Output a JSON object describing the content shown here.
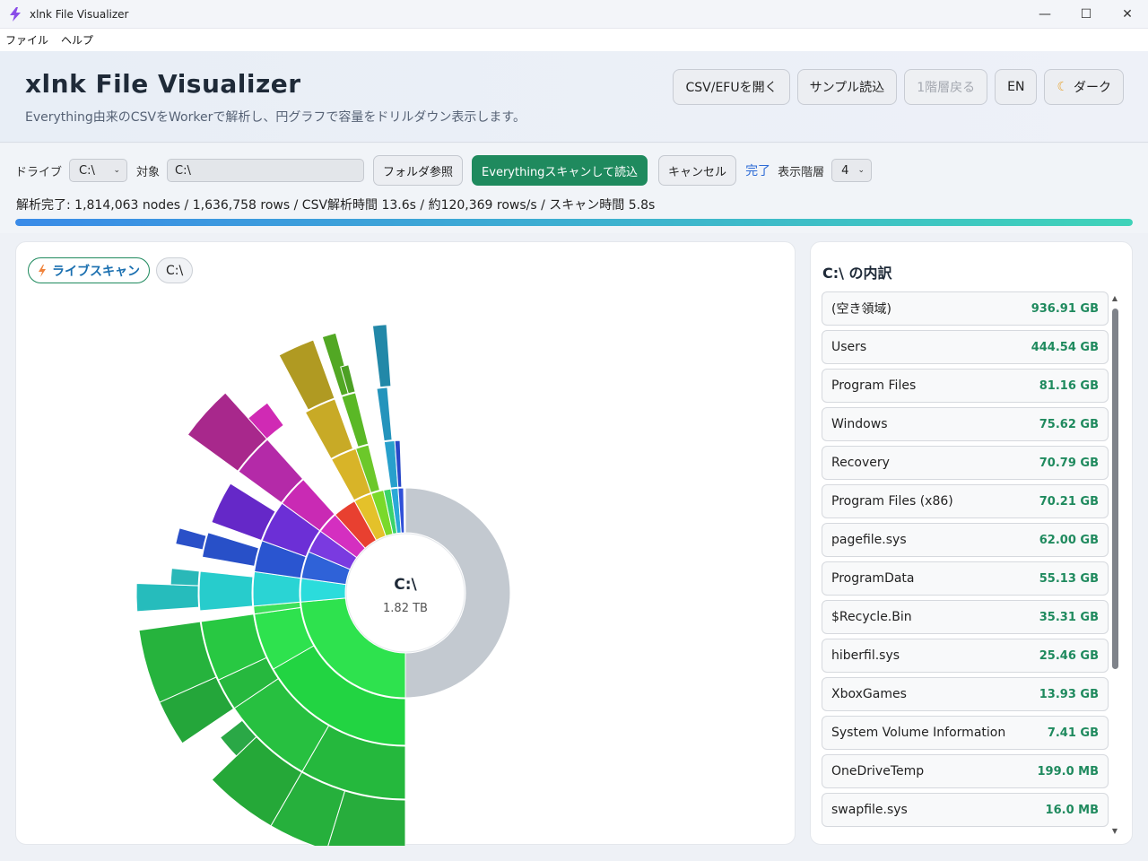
{
  "window": {
    "title": "xlnk File Visualizer",
    "minimize": "—",
    "maximize": "☐",
    "close": "✕"
  },
  "menu": {
    "file": "ファイル",
    "help": "ヘルプ"
  },
  "header": {
    "app_name": "xlnk File Visualizer",
    "subtitle": "Everything由来のCSVをWorkerで解析し、円グラフで容量をドリルダウン表示します。",
    "btn_open": "CSV/EFUを開く",
    "btn_sample": "サンプル読込",
    "btn_up": "1階層戻る",
    "btn_lang": "EN",
    "btn_theme": "ダーク",
    "theme_icon": "moon-icon"
  },
  "toolbar": {
    "drive_label": "ドライブ",
    "drive_value": "C:\\",
    "target_label": "対象",
    "target_value": "C:\\",
    "browse": "フォルダ参照",
    "scan": "Everythingスキャンして読込",
    "cancel": "キャンセル",
    "status": "完了",
    "depth_label": "表示階層",
    "depth_value": "4",
    "status_line": "解析完了: 1,814,063 nodes / 1,636,758 rows / CSV解析時間 13.6s / 約120,369 rows/s / スキャン時間 5.8s",
    "progress": 1.0
  },
  "chart": {
    "live_label": "ライブスキャン",
    "live_icon": "lightning-icon",
    "crumb_root": "C:\\",
    "center_label": "C:\\",
    "center_size": "1.82 TB"
  },
  "panel": {
    "title": "C:\\ の内訳",
    "items": [
      {
        "name": "(空き領域)",
        "size": "936.91 GB"
      },
      {
        "name": "Users",
        "size": "444.54 GB"
      },
      {
        "name": "Program Files",
        "size": "81.16 GB"
      },
      {
        "name": "Windows",
        "size": "75.62 GB"
      },
      {
        "name": "Recovery",
        "size": "70.79 GB"
      },
      {
        "name": "Program Files (x86)",
        "size": "70.21 GB"
      },
      {
        "name": "pagefile.sys",
        "size": "62.00 GB"
      },
      {
        "name": "ProgramData",
        "size": "55.13 GB"
      },
      {
        "name": "$Recycle.Bin",
        "size": "35.31 GB"
      },
      {
        "name": "hiberfil.sys",
        "size": "25.46 GB"
      },
      {
        "name": "XboxGames",
        "size": "13.93 GB"
      },
      {
        "name": "System Volume Information",
        "size": "7.41 GB"
      },
      {
        "name": "OneDriveTemp",
        "size": "199.0 MB"
      },
      {
        "name": "swapfile.sys",
        "size": "16.0 MB"
      }
    ]
  }
}
